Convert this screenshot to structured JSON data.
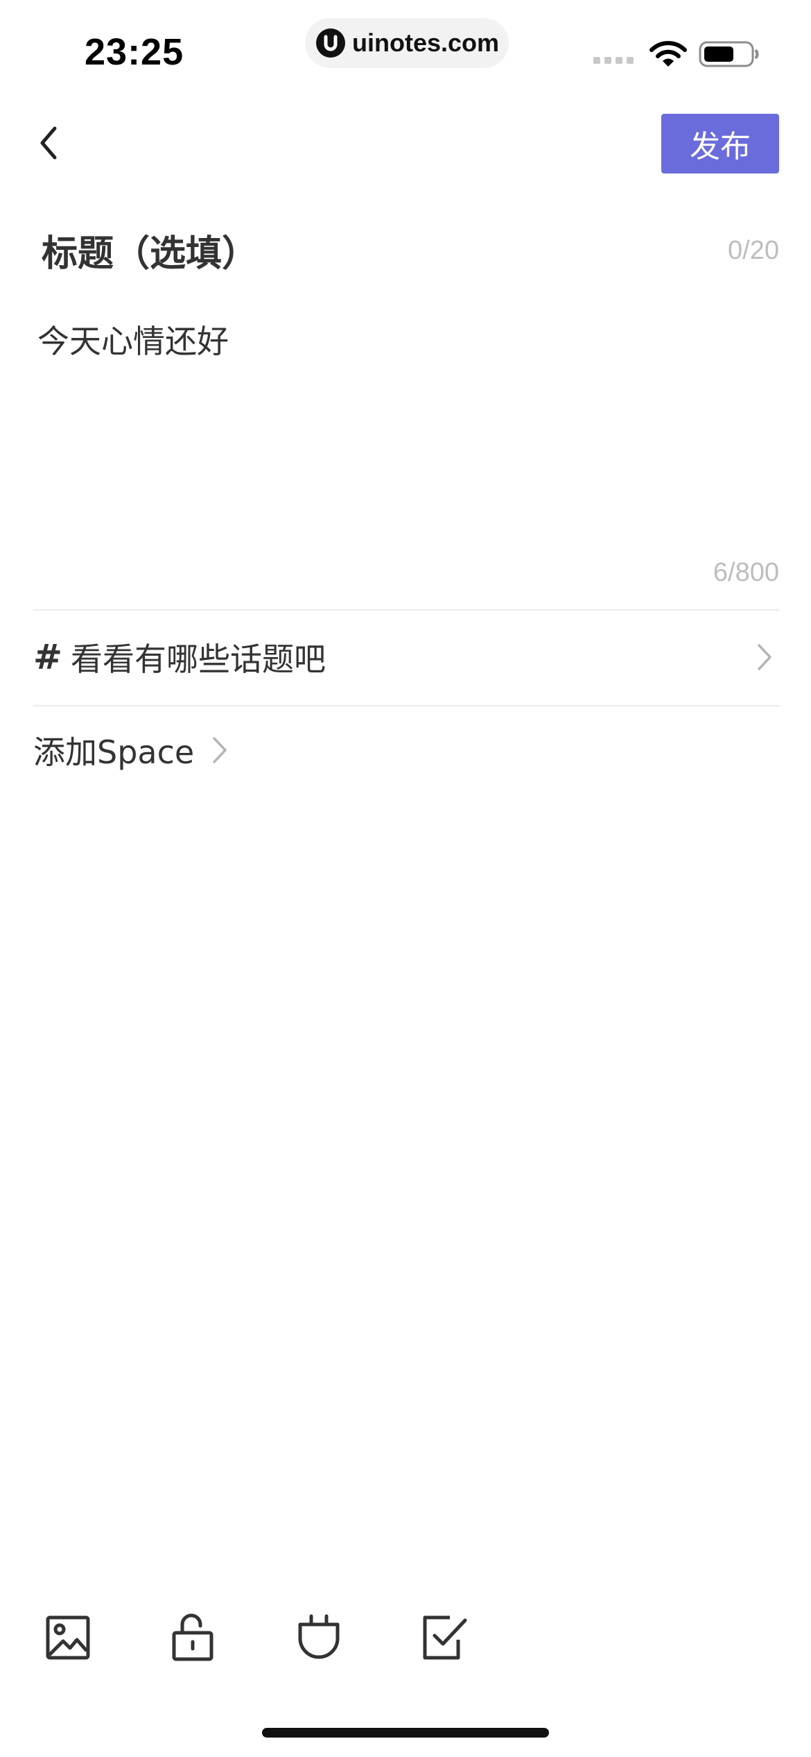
{
  "status_bar": {
    "time": "23:25",
    "url": "uinotes.com"
  },
  "nav": {
    "publish_label": "发布"
  },
  "post": {
    "title_placeholder": "标题（选填）",
    "title_count": "0/20",
    "body_text": "今天心情还好",
    "body_count": "6/800"
  },
  "topic": {
    "hash": "#",
    "label": "看看有哪些话题吧"
  },
  "space": {
    "label": "添加Space"
  },
  "toolbar": {
    "items": [
      "image-icon",
      "unlock-icon",
      "plug-icon",
      "checkbox-icon"
    ]
  },
  "colors": {
    "accent": "#6a6cdb",
    "text": "#333333",
    "muted": "#bdbdbd",
    "divider": "#ececec"
  }
}
